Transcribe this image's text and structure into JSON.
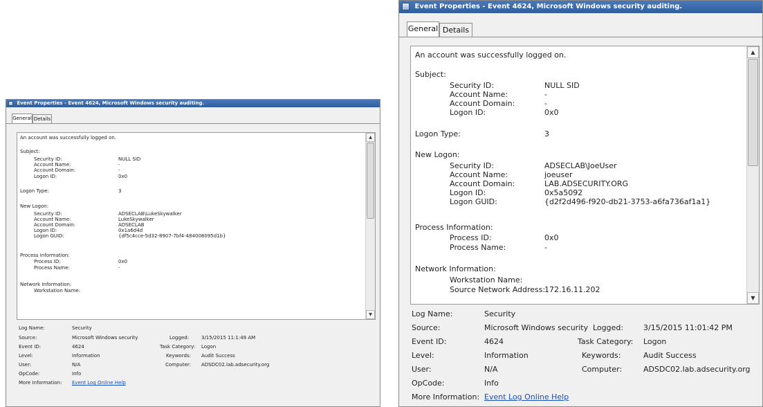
{
  "window_title": "Event Properties - Event 4624, Microsoft Windows security auditing.",
  "tabs": [
    {
      "label": "General"
    },
    {
      "label": "Details"
    }
  ],
  "left": {
    "description": {
      "intro": "An account was successfully logged on.",
      "subject_header": "Subject:",
      "subject": [
        {
          "label": "Security ID:",
          "value": "NULL SID"
        },
        {
          "label": "Account Name:",
          "value": "-"
        },
        {
          "label": "Account Domain:",
          "value": "-"
        },
        {
          "label": "Logon ID:",
          "value": "0x0"
        }
      ],
      "logon_type": {
        "label": "Logon Type:",
        "value": "3"
      },
      "new_logon_header": "New Logon:",
      "new_logon": [
        {
          "label": "Security ID:",
          "value": "ADSECLAB\\LukeSkywalker"
        },
        {
          "label": "Account Name:",
          "value": "LukeSkywalker"
        },
        {
          "label": "Account Domain:",
          "value": "ADSECLAB"
        },
        {
          "label": "Logon ID:",
          "value": "0x1a6d4d"
        },
        {
          "label": "Logon GUID:",
          "value": "{df5c4cce-5d32-8907-7bf4-484008095d1b}"
        }
      ],
      "process_header": "Process Information:",
      "process": [
        {
          "label": "Process ID:",
          "value": "0x0"
        },
        {
          "label": "Process Name:",
          "value": "-"
        }
      ],
      "network_header": "Network Information:",
      "network": [
        {
          "label": "Workstation Name:",
          "value": ""
        }
      ]
    },
    "meta": {
      "log_name": {
        "label": "Log Name:",
        "value": "Security"
      },
      "source": {
        "label": "Source:",
        "value": "Microsoft Windows security"
      },
      "logged": {
        "label": "Logged:",
        "value": "3/15/2015 11:1:49 AM"
      },
      "event_id": {
        "label": "Event ID:",
        "value": "4624"
      },
      "task_category": {
        "label": "Task Category:",
        "value": "Logon"
      },
      "level": {
        "label": "Level:",
        "value": "Information"
      },
      "keywords": {
        "label": "Keywords:",
        "value": "Audit Success"
      },
      "user": {
        "label": "User:",
        "value": "N/A"
      },
      "computer": {
        "label": "Computer:",
        "value": "ADSDC02.lab.adsecurity.org"
      },
      "opcode": {
        "label": "OpCode:",
        "value": "Info"
      },
      "more_info": {
        "label": "More Information:",
        "link": "Event Log Online Help"
      }
    }
  },
  "right": {
    "description": {
      "intro": "An account was successfully logged on.",
      "subject_header": "Subject:",
      "subject": [
        {
          "label": "Security ID:",
          "value": "NULL SID"
        },
        {
          "label": "Account Name:",
          "value": "-"
        },
        {
          "label": "Account Domain:",
          "value": "-"
        },
        {
          "label": "Logon ID:",
          "value": "0x0"
        }
      ],
      "logon_type": {
        "label": "Logon Type:",
        "value": "3"
      },
      "new_logon_header": "New Logon:",
      "new_logon": [
        {
          "label": "Security ID:",
          "value": "ADSECLAB\\JoeUser"
        },
        {
          "label": "Account Name:",
          "value": "joeuser"
        },
        {
          "label": "Account Domain:",
          "value": "LAB.ADSECURITY.ORG"
        },
        {
          "label": "Logon ID:",
          "value": "0x5a5092"
        },
        {
          "label": "Logon GUID:",
          "value": "{d2f2d496-f920-db21-3753-a6fa736af1a1}"
        }
      ],
      "process_header": "Process Information:",
      "process": [
        {
          "label": "Process ID:",
          "value": "0x0"
        },
        {
          "label": "Process Name:",
          "value": "-"
        }
      ],
      "network_header": "Network Information:",
      "network": [
        {
          "label": "Workstation Name:",
          "value": ""
        },
        {
          "label": "Source Network Address:",
          "value": "172.16.11.202"
        }
      ]
    },
    "meta": {
      "log_name": {
        "label": "Log Name:",
        "value": "Security"
      },
      "source": {
        "label": "Source:",
        "value": "Microsoft Windows security"
      },
      "logged": {
        "label": "Logged:",
        "value": "3/15/2015 11:01:42 PM"
      },
      "event_id": {
        "label": "Event ID:",
        "value": "4624"
      },
      "task_category": {
        "label": "Task Category:",
        "value": "Logon"
      },
      "level": {
        "label": "Level:",
        "value": "Information"
      },
      "keywords": {
        "label": "Keywords:",
        "value": "Audit Success"
      },
      "user": {
        "label": "User:",
        "value": "N/A"
      },
      "computer": {
        "label": "Computer:",
        "value": "ADSDC02.lab.adsecurity.org"
      },
      "opcode": {
        "label": "OpCode:",
        "value": "Info"
      },
      "more_info": {
        "label": "More Information:",
        "link": "Event Log Online Help"
      }
    }
  }
}
